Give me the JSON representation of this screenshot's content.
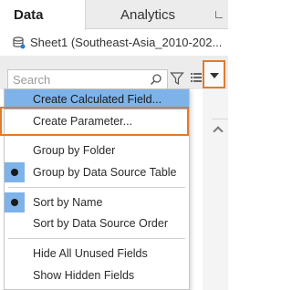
{
  "tabs": {
    "data_label": "Data",
    "analytics_label": "Analytics"
  },
  "datasource": {
    "label": "Sheet1 (Southeast-Asia_2010-202...",
    "icon": "database-icon"
  },
  "search": {
    "placeholder": "Search"
  },
  "menu": {
    "items": [
      {
        "label": "Create Calculated Field...",
        "checked": false,
        "highlighted": true
      },
      {
        "label": "Create Parameter...",
        "checked": false,
        "highlighted": false
      },
      {
        "label": "Group by Folder",
        "checked": false,
        "highlighted": false
      },
      {
        "label": "Group by Data Source Table",
        "checked": true,
        "highlighted": false
      },
      {
        "label": "Sort by Name",
        "checked": true,
        "highlighted": false
      },
      {
        "label": "Sort by Data Source Order",
        "checked": false,
        "highlighted": false
      },
      {
        "label": "Hide All Unused Fields",
        "checked": false,
        "highlighted": false
      },
      {
        "label": "Show Hidden Fields",
        "checked": false,
        "highlighted": false
      }
    ]
  },
  "colors": {
    "hover_blue": "#7db3e8",
    "callout_orange": "#e07b2e"
  }
}
